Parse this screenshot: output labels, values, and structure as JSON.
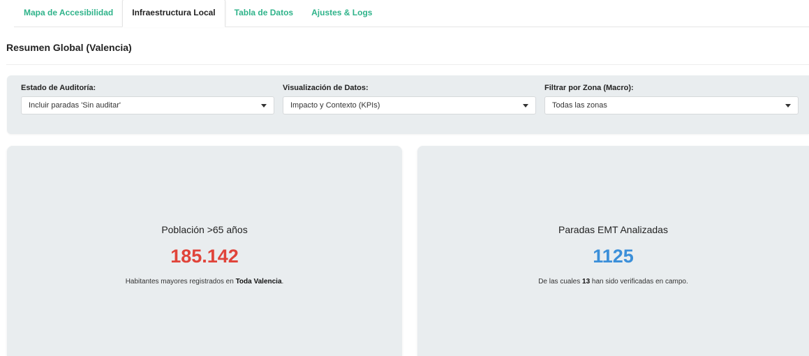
{
  "tabs": [
    {
      "label": "Mapa de Accesibilidad",
      "active": false
    },
    {
      "label": "Infraestructura Local",
      "active": true
    },
    {
      "label": "Tabla de Datos",
      "active": false
    },
    {
      "label": "Ajustes & Logs",
      "active": false
    }
  ],
  "page": {
    "title": "Resumen Global (Valencia)"
  },
  "filters": {
    "audit_state": {
      "label": "Estado de Auditoría:",
      "value": "Incluir paradas 'Sin auditar'"
    },
    "visualization": {
      "label": "Visualización de Datos:",
      "value": "Impacto y Contexto (KPIs)"
    },
    "zone": {
      "label": "Filtrar por Zona (Macro):",
      "value": "Todas las zonas"
    }
  },
  "kpis": {
    "population": {
      "title": "Población >65 años",
      "value": "185.142",
      "value_color": "#e0443a",
      "desc_prefix": "Habitantes mayores registrados en ",
      "desc_bold": "Toda Valencia",
      "desc_suffix": "."
    },
    "stops": {
      "title": "Paradas EMT Analizadas",
      "value": "1125",
      "value_color": "#3b8fd9",
      "desc_prefix": "De las cuales ",
      "desc_bold": "13",
      "desc_suffix": " han sido verificadas en campo."
    }
  },
  "colors": {
    "tab_accent": "#2fb38a",
    "panel_bg": "#e9edef"
  }
}
